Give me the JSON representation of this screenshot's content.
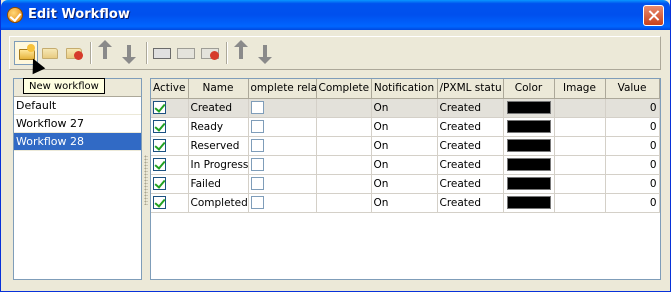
{
  "window": {
    "title": "Edit Workflow"
  },
  "toolbar": {
    "buttons": [
      {
        "icon": "new-workflow-icon"
      },
      {
        "icon": "edit-workflow-icon"
      },
      {
        "icon": "delete-workflow-icon"
      },
      {
        "icon": "move-workflow-up-icon"
      },
      {
        "icon": "move-workflow-down-icon"
      },
      {
        "icon": "new-status-icon"
      },
      {
        "icon": "edit-status-icon"
      },
      {
        "icon": "delete-status-icon"
      },
      {
        "icon": "move-status-up-icon"
      },
      {
        "icon": "move-status-down-icon"
      }
    ],
    "tooltip": "New workflow"
  },
  "workflows": {
    "items": [
      {
        "label": "Default"
      },
      {
        "label": "Workflow 27"
      },
      {
        "label": "Workflow 28"
      }
    ],
    "selected_index": 2
  },
  "grid": {
    "columns": [
      "Active",
      "Name",
      "omplete relat",
      "Complete",
      "Notification",
      "/PXML statu",
      "Color",
      "Image",
      "Value"
    ],
    "rows": [
      {
        "active": true,
        "name": "Created",
        "complete_related": false,
        "complete": "",
        "notification": "On",
        "pxml_status": "Created",
        "color": "#000000",
        "image": "",
        "value": "0"
      },
      {
        "active": true,
        "name": "Ready",
        "complete_related": false,
        "complete": "",
        "notification": "On",
        "pxml_status": "Created",
        "color": "#000000",
        "image": "",
        "value": "0"
      },
      {
        "active": true,
        "name": "Reserved",
        "complete_related": false,
        "complete": "",
        "notification": "On",
        "pxml_status": "Created",
        "color": "#000000",
        "image": "",
        "value": "0"
      },
      {
        "active": true,
        "name": "In Progress",
        "complete_related": false,
        "complete": "",
        "notification": "On",
        "pxml_status": "Created",
        "color": "#000000",
        "image": "",
        "value": "0"
      },
      {
        "active": true,
        "name": "Failed",
        "complete_related": false,
        "complete": "",
        "notification": "On",
        "pxml_status": "Created",
        "color": "#000000",
        "image": "",
        "value": "0"
      },
      {
        "active": true,
        "name": "Completed",
        "complete_related": false,
        "complete": "",
        "notification": "On",
        "pxml_status": "Created",
        "color": "#000000",
        "image": "",
        "value": "0"
      }
    ]
  },
  "colors": {
    "title_bar": "#0054e3",
    "selection": "#316ac5",
    "check": "#21a121"
  }
}
